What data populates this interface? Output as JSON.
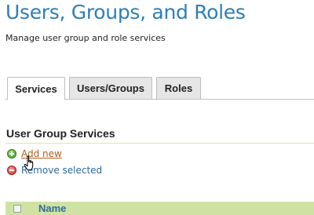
{
  "page": {
    "title": "Users, Groups, and Roles",
    "description": "Manage user group and role services"
  },
  "tabs": [
    {
      "label": "Services",
      "active": true
    },
    {
      "label": "Users/Groups",
      "active": false
    },
    {
      "label": "Roles",
      "active": false
    }
  ],
  "section": {
    "title": "User Group Services",
    "actions": {
      "add_new": {
        "label": "Add new",
        "icon": "plus-icon"
      },
      "remove_selected": {
        "label": "Remove selected",
        "icon": "minus-icon"
      }
    }
  },
  "table": {
    "columns": [
      "Name"
    ]
  },
  "colors": {
    "title": "#2d7fb7",
    "tab_bg": "#e6e6e6",
    "table_header_bg": "#cfe2a4",
    "link_hover": "#b05f1e",
    "link": "#2a6a9e"
  },
  "cursor": {
    "icon": "hand-pointer-icon"
  }
}
